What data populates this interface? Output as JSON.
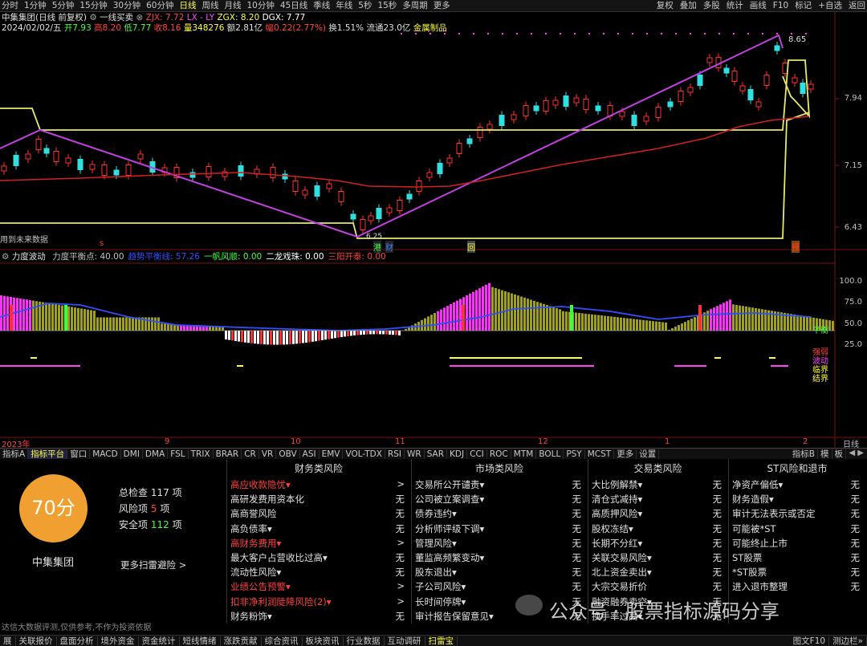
{
  "topbar": {
    "periods": [
      "分时",
      "1分钟",
      "5分钟",
      "15分钟",
      "30分钟",
      "60分钟",
      "日线",
      "周线",
      "月线",
      "10分钟",
      "45日线",
      "季线",
      "年线",
      "5秒",
      "15秒",
      "多周期",
      "更多"
    ],
    "active": "日线",
    "right": [
      "复权",
      "叠加",
      "多股",
      "统计",
      "画线",
      "F10",
      "标记",
      "+自选",
      "返回"
    ]
  },
  "header": {
    "title": "中集集团(日线 前复权)",
    "indicator": "一线买卖",
    "zjx": "ZJX: 7.72",
    "lx": "LX - LY",
    "zgx": "ZGX: 8.20",
    "dgx": "DGX: 7.77",
    "date": "2024/02/02/五",
    "kai": "开7.93",
    "gao": "高8.20",
    "di": "低7.77",
    "shou": "收8.16",
    "liang": "量348276",
    "e": "额2.81亿",
    "fu": "幅0.22(2.77%)",
    "huan": "换1.51%",
    "liutong": "流通23.0亿",
    "sector": "金属制品"
  },
  "price_axis": {
    "labels": [
      "7.94",
      "7.15",
      "6.43"
    ],
    "high_label": "8.65",
    "low_label": "6.25"
  },
  "chart_notes": {
    "future": "用到未来数据",
    "s": "s",
    "gang": "港",
    "cai": "财",
    "hui": "回",
    "yu": "预"
  },
  "indicator": {
    "name": "力度波动",
    "params": [
      {
        "label": "力度平衡点: 40.00",
        "color": "#c0c0c0"
      },
      {
        "label": "趋势平衡线: 57.26",
        "color": "#3050ff"
      },
      {
        "label": "一帆风顺: 0.00",
        "color": "#40ff40"
      },
      {
        "label": "二龙戏珠: 0.00",
        "color": "#ffffff"
      },
      {
        "label": "三阳开泰: 0.00",
        "color": "#ff4040"
      }
    ],
    "axis": [
      "100.0",
      "75.0",
      "50.0",
      "25.0"
    ],
    "right_labels": [
      {
        "t": "平衡",
        "c": "#40ff40"
      },
      {
        "t": "强弱",
        "c": "#ff4040"
      },
      {
        "t": "波动",
        "c": "#ff40ff"
      },
      {
        "t": "临界",
        "c": "#ffff40"
      },
      {
        "t": "结界",
        "c": "#ffff40"
      }
    ]
  },
  "timeaxis": {
    "labels": [
      "2023年",
      "9",
      "10",
      "11",
      "12",
      "1",
      "2"
    ],
    "right": "日线"
  },
  "tabs": [
    "指标A",
    "指标平台",
    "窗口",
    "MACD",
    "DMI",
    "DMA",
    "FSL",
    "TRIX",
    "BRAR",
    "CR",
    "VR",
    "OBV",
    "ASI",
    "EMV",
    "VOL-TDX",
    "RSI",
    "WR",
    "SAR",
    "KDJ",
    "CCI",
    "ROC",
    "MTM",
    "BOLL",
    "PSY",
    "MCST",
    "更多",
    "设置"
  ],
  "tabs_right": [
    "指标B",
    "模",
    "板"
  ],
  "score": {
    "value": "70分",
    "company": "中集集团",
    "total_label": "总检查",
    "total": "117",
    "total_unit": "项",
    "risk_label": "风险项",
    "risk": "5",
    "risk_unit": "项",
    "safe_label": "安全项",
    "safe": "112",
    "safe_unit": "项",
    "more": "更多扫雷避险 >",
    "disclaimer": "达信大数据评测,仅供参考,不作为投资依据"
  },
  "columns": [
    {
      "title": "财务类风险",
      "items": [
        {
          "t": "高应收款隐忧▾",
          "v": ">",
          "red": true
        },
        {
          "t": "高研发费用资本化",
          "v": "无"
        },
        {
          "t": "高商誉风险",
          "v": "无"
        },
        {
          "t": "高负债率▾",
          "v": "无"
        },
        {
          "t": "高财务费用▾",
          "v": ">",
          "red": true
        },
        {
          "t": "最大客户占营收比过高▾",
          "v": "无"
        },
        {
          "t": "流动性风险▾",
          "v": "无"
        },
        {
          "t": "业绩公告预警▾",
          "v": ">",
          "red": true
        },
        {
          "t": "扣非净利润陡降风险(2)▾",
          "v": ">",
          "red": true
        },
        {
          "t": "财务粉饰▾",
          "v": "无"
        }
      ]
    },
    {
      "title": "市场类风险",
      "items": [
        {
          "t": "交易所公开谴责▾",
          "v": "无"
        },
        {
          "t": "公司被立案调查▾",
          "v": "无"
        },
        {
          "t": "债券违约▾",
          "v": "无"
        },
        {
          "t": "分析师评级下调▾",
          "v": "无"
        },
        {
          "t": "管理风险▾",
          "v": "无"
        },
        {
          "t": "董监高频繁变动▾",
          "v": "无"
        },
        {
          "t": "股东退出▾",
          "v": "无"
        },
        {
          "t": "子公司风险▾",
          "v": "无"
        },
        {
          "t": "长时间停牌▾",
          "v": "无"
        },
        {
          "t": "审计报告保留意见▾",
          "v": "无"
        }
      ]
    },
    {
      "title": "交易类风险",
      "items": [
        {
          "t": "大比例解禁▾",
          "v": "无"
        },
        {
          "t": "清仓式减持▾",
          "v": "无"
        },
        {
          "t": "高质押风险▾",
          "v": "无"
        },
        {
          "t": "股权冻结▾",
          "v": "无"
        },
        {
          "t": "长期不分红▾",
          "v": "无"
        },
        {
          "t": "关联交易风险▾",
          "v": "无"
        },
        {
          "t": "北上资金卖出▾",
          "v": "无"
        },
        {
          "t": "大宗交易折价",
          "v": "无"
        },
        {
          "t": "融资融券卖空▾",
          "v": "无"
        },
        {
          "t": "换手率过高▾",
          "v": "无"
        }
      ]
    },
    {
      "title": "ST风险和退市",
      "items": [
        {
          "t": "净资产偏低▾",
          "v": "无"
        },
        {
          "t": "财务造假▾",
          "v": "无"
        },
        {
          "t": "审计无法表示或否定",
          "v": "无"
        },
        {
          "t": "可能被*ST",
          "v": "无"
        },
        {
          "t": "可能终止上市",
          "v": "无"
        },
        {
          "t": "ST股票",
          "v": "无"
        },
        {
          "t": "*ST股票",
          "v": "无"
        },
        {
          "t": "进入退市整理",
          "v": "无"
        }
      ]
    }
  ],
  "watermark": "公众号 · 股票指标源码分享",
  "statusbar": {
    "items": [
      "展",
      "关联报价",
      "盘面分析",
      "境外资金",
      "资金统计",
      "短线情绪",
      "涨跌贡献",
      "综合资讯",
      "板块资讯",
      "行业数据",
      "互动调研",
      "扫雷宝"
    ],
    "right": [
      "图文F10",
      "测边栏»"
    ]
  }
}
